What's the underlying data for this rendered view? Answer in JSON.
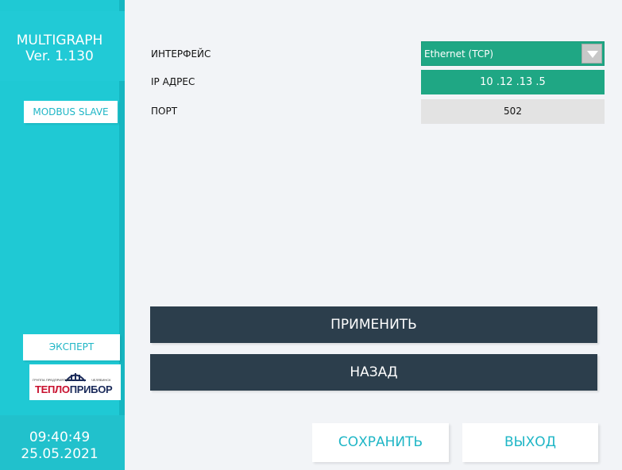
{
  "sidebar": {
    "app_title": "MULTIGRAPH",
    "app_version": "Ver. 1.130",
    "modbus_label": "MODBUS SLAVE",
    "expert_label": "ЭКСПЕРТ",
    "logo": {
      "left_small": "ГРУППА ПРЕДПРИЯТИЙ",
      "right_small": "ЧЕЛЯБИНСК",
      "brand_red": "ТЕПЛО",
      "brand_dark": "ПРИБОР"
    },
    "clock_time": "09:40:49",
    "clock_date": "25.05.2021"
  },
  "form": {
    "interface_label": "ИНТЕРФЕЙС",
    "interface_value": "Ethernet (TCP)",
    "ip_label": "IP АДРЕС",
    "ip_value": "10 .12 .13 .5",
    "port_label": "ПОРТ",
    "port_value": "502"
  },
  "actions": {
    "apply_label": "ПРИМЕНИТЬ",
    "back_label": "НАЗАД",
    "save_label": "СОХРАНИТЬ",
    "exit_label": "ВЫХОД"
  },
  "colors": {
    "sidebar": "#1fc9d4",
    "field_active": "#1fa784",
    "dark_button": "#2c3e4c",
    "accent_text": "#1fb6c6"
  }
}
